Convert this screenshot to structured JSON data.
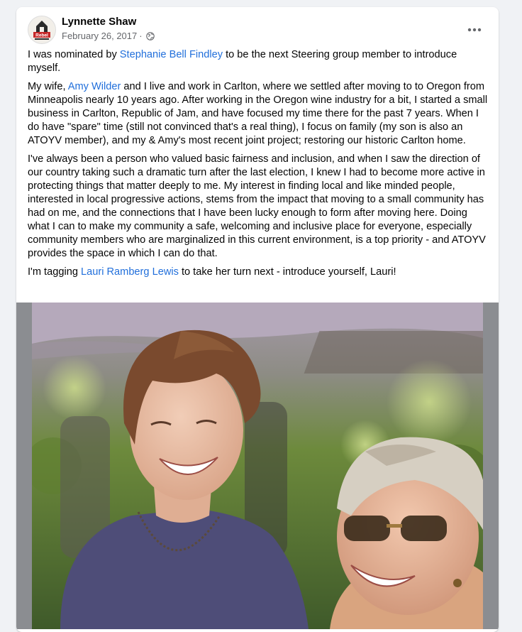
{
  "post": {
    "author": "Lynnette Shaw",
    "date": "February 26, 2017",
    "separator": "·",
    "privacy_icon": "globe-icon",
    "more_icon": "more-horizontal-icon",
    "avatar_icon": "avatar-logo",
    "avatar_text": "Rebel"
  },
  "content": {
    "p1": {
      "before": "I was nominated by ",
      "mention": "Stephanie Bell Findley",
      "after": " to be the next Steering group member to introduce myself."
    },
    "p2": {
      "before": "My wife, ",
      "mention": "Amy Wilder",
      "after": " and I live and work in Carlton, where we settled after moving to to Oregon from Minneapolis nearly 10 years ago. After working in the Oregon wine industry for a bit, I started a small business in Carlton, Republic of Jam, and have focused my time there for the past 7 years. When I do have \"spare\" time (still not convinced that's a real thing), I focus on family (my son is also an ATOYV member), and my & Amy's most recent joint project; restoring our historic Carlton home."
    },
    "p3": "I've always been a person who valued basic fairness and inclusion, and when I saw the direction of our country taking such a dramatic turn after the last election, I knew I had to become more active in protecting things that matter deeply to me. My interest in finding local and like minded people, interested in local progressive actions, stems from the impact that moving to a small community has had on me, and the connections that I have been lucky enough to form after moving here. Doing what I can to make my community a safe, welcoming and inclusive place for everyone, especially community members who are marginalized in this current environment, is a top priority - and ATOYV provides the space in which I can do that.",
    "p4": {
      "before": "I'm tagging ",
      "mention": "Lauri Ramberg Lewis",
      "after": " to take her turn next - introduce yourself, Lauri!"
    }
  },
  "photo": {
    "subject": "two-women-laughing-photo"
  },
  "colors": {
    "link": "#216fdb",
    "meta": "#65676b",
    "card": "#ffffff",
    "page_bg": "#f0f2f5",
    "photo_letterbox": "#8b8d91"
  }
}
